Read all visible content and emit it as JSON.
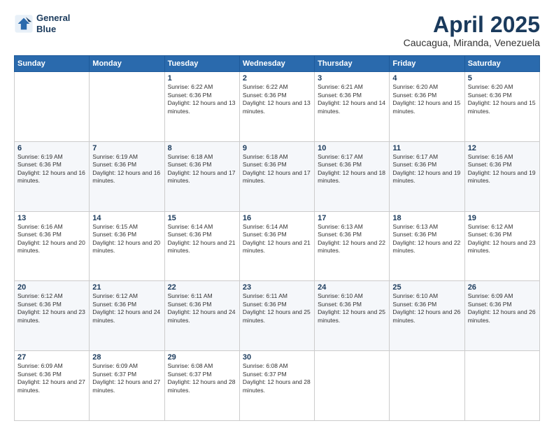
{
  "header": {
    "logo_line1": "General",
    "logo_line2": "Blue",
    "month_title": "April 2025",
    "location": "Caucagua, Miranda, Venezuela"
  },
  "weekdays": [
    "Sunday",
    "Monday",
    "Tuesday",
    "Wednesday",
    "Thursday",
    "Friday",
    "Saturday"
  ],
  "weeks": [
    [
      {
        "day": "",
        "info": ""
      },
      {
        "day": "",
        "info": ""
      },
      {
        "day": "1",
        "info": "Sunrise: 6:22 AM\nSunset: 6:36 PM\nDaylight: 12 hours and 13 minutes."
      },
      {
        "day": "2",
        "info": "Sunrise: 6:22 AM\nSunset: 6:36 PM\nDaylight: 12 hours and 13 minutes."
      },
      {
        "day": "3",
        "info": "Sunrise: 6:21 AM\nSunset: 6:36 PM\nDaylight: 12 hours and 14 minutes."
      },
      {
        "day": "4",
        "info": "Sunrise: 6:20 AM\nSunset: 6:36 PM\nDaylight: 12 hours and 15 minutes."
      },
      {
        "day": "5",
        "info": "Sunrise: 6:20 AM\nSunset: 6:36 PM\nDaylight: 12 hours and 15 minutes."
      }
    ],
    [
      {
        "day": "6",
        "info": "Sunrise: 6:19 AM\nSunset: 6:36 PM\nDaylight: 12 hours and 16 minutes."
      },
      {
        "day": "7",
        "info": "Sunrise: 6:19 AM\nSunset: 6:36 PM\nDaylight: 12 hours and 16 minutes."
      },
      {
        "day": "8",
        "info": "Sunrise: 6:18 AM\nSunset: 6:36 PM\nDaylight: 12 hours and 17 minutes."
      },
      {
        "day": "9",
        "info": "Sunrise: 6:18 AM\nSunset: 6:36 PM\nDaylight: 12 hours and 17 minutes."
      },
      {
        "day": "10",
        "info": "Sunrise: 6:17 AM\nSunset: 6:36 PM\nDaylight: 12 hours and 18 minutes."
      },
      {
        "day": "11",
        "info": "Sunrise: 6:17 AM\nSunset: 6:36 PM\nDaylight: 12 hours and 19 minutes."
      },
      {
        "day": "12",
        "info": "Sunrise: 6:16 AM\nSunset: 6:36 PM\nDaylight: 12 hours and 19 minutes."
      }
    ],
    [
      {
        "day": "13",
        "info": "Sunrise: 6:16 AM\nSunset: 6:36 PM\nDaylight: 12 hours and 20 minutes."
      },
      {
        "day": "14",
        "info": "Sunrise: 6:15 AM\nSunset: 6:36 PM\nDaylight: 12 hours and 20 minutes."
      },
      {
        "day": "15",
        "info": "Sunrise: 6:14 AM\nSunset: 6:36 PM\nDaylight: 12 hours and 21 minutes."
      },
      {
        "day": "16",
        "info": "Sunrise: 6:14 AM\nSunset: 6:36 PM\nDaylight: 12 hours and 21 minutes."
      },
      {
        "day": "17",
        "info": "Sunrise: 6:13 AM\nSunset: 6:36 PM\nDaylight: 12 hours and 22 minutes."
      },
      {
        "day": "18",
        "info": "Sunrise: 6:13 AM\nSunset: 6:36 PM\nDaylight: 12 hours and 22 minutes."
      },
      {
        "day": "19",
        "info": "Sunrise: 6:12 AM\nSunset: 6:36 PM\nDaylight: 12 hours and 23 minutes."
      }
    ],
    [
      {
        "day": "20",
        "info": "Sunrise: 6:12 AM\nSunset: 6:36 PM\nDaylight: 12 hours and 23 minutes."
      },
      {
        "day": "21",
        "info": "Sunrise: 6:12 AM\nSunset: 6:36 PM\nDaylight: 12 hours and 24 minutes."
      },
      {
        "day": "22",
        "info": "Sunrise: 6:11 AM\nSunset: 6:36 PM\nDaylight: 12 hours and 24 minutes."
      },
      {
        "day": "23",
        "info": "Sunrise: 6:11 AM\nSunset: 6:36 PM\nDaylight: 12 hours and 25 minutes."
      },
      {
        "day": "24",
        "info": "Sunrise: 6:10 AM\nSunset: 6:36 PM\nDaylight: 12 hours and 25 minutes."
      },
      {
        "day": "25",
        "info": "Sunrise: 6:10 AM\nSunset: 6:36 PM\nDaylight: 12 hours and 26 minutes."
      },
      {
        "day": "26",
        "info": "Sunrise: 6:09 AM\nSunset: 6:36 PM\nDaylight: 12 hours and 26 minutes."
      }
    ],
    [
      {
        "day": "27",
        "info": "Sunrise: 6:09 AM\nSunset: 6:36 PM\nDaylight: 12 hours and 27 minutes."
      },
      {
        "day": "28",
        "info": "Sunrise: 6:09 AM\nSunset: 6:37 PM\nDaylight: 12 hours and 27 minutes."
      },
      {
        "day": "29",
        "info": "Sunrise: 6:08 AM\nSunset: 6:37 PM\nDaylight: 12 hours and 28 minutes."
      },
      {
        "day": "30",
        "info": "Sunrise: 6:08 AM\nSunset: 6:37 PM\nDaylight: 12 hours and 28 minutes."
      },
      {
        "day": "",
        "info": ""
      },
      {
        "day": "",
        "info": ""
      },
      {
        "day": "",
        "info": ""
      }
    ]
  ]
}
